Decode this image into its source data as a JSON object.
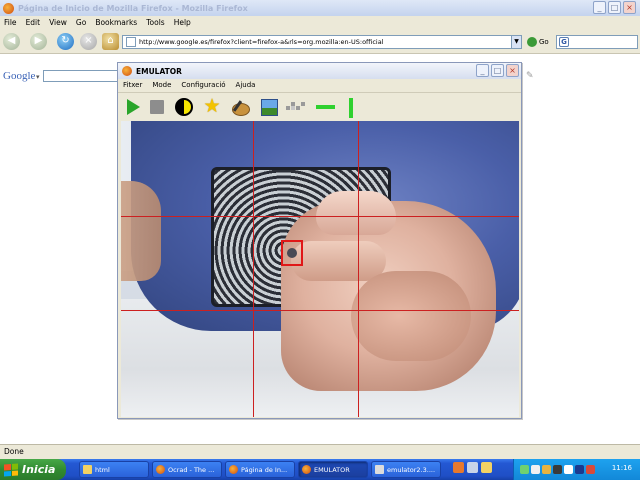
{
  "firefox": {
    "title": "Página de Inicio de Mozilla Firefox - Mozilla Firefox",
    "menu": [
      "File",
      "Edit",
      "View",
      "Go",
      "Bookmarks",
      "Tools",
      "Help"
    ],
    "url": "http://www.google.es/firefox?client=firefox-a&rls=org.mozilla:en-US:official",
    "go_label": "Go",
    "google_search_value": "",
    "google_toolbar_logo": "Google",
    "status": "Done"
  },
  "emulator": {
    "title": "EMULATOR",
    "menu": [
      "Fitxer",
      "Mode",
      "Configuració",
      "Ajuda"
    ],
    "toolbar_icons": [
      "play-icon",
      "stop-icon",
      "contrast-icon",
      "star-icon",
      "palette-icon",
      "image-icon",
      "pixels-icon",
      "horizontal-line-icon",
      "vertical-line-icon"
    ],
    "grid_color": "#cc2020",
    "marker_color": "#e01818"
  },
  "taskbar": {
    "start_label": "Inicia",
    "tasks": [
      {
        "label": "html",
        "icon": "folder-icon",
        "active": false
      },
      {
        "label": "Ocrad - The ...",
        "icon": "firefox-icon",
        "active": false
      },
      {
        "label": "Página de In...",
        "icon": "firefox-icon",
        "active": false
      },
      {
        "label": "EMULATOR",
        "icon": "firefox-icon",
        "active": true
      },
      {
        "label": "emulator2.3....",
        "icon": "document-icon",
        "active": false
      }
    ],
    "clock": "11:16"
  }
}
